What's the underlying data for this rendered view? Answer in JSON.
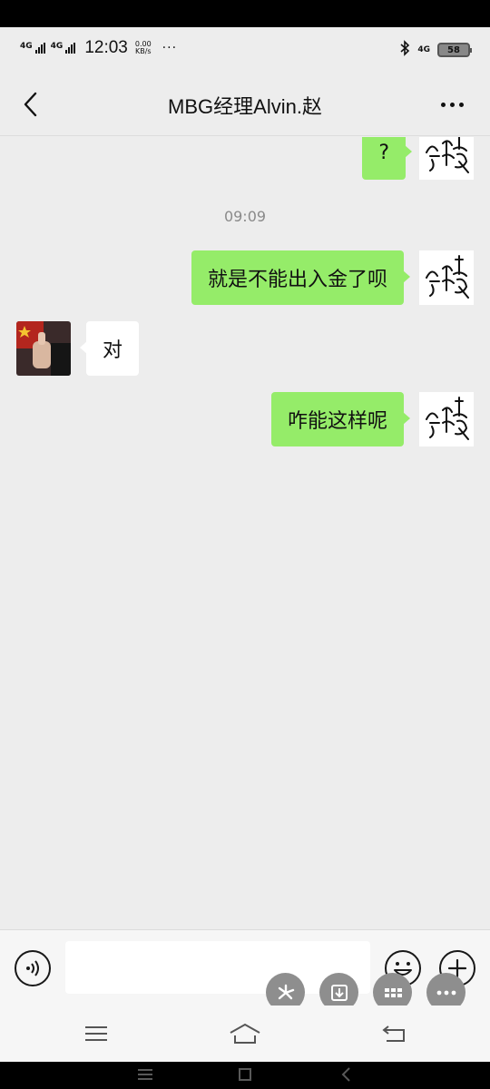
{
  "status_bar": {
    "network_1": "4G",
    "network_2": "4G",
    "time": "12:03",
    "speed_value": "0.00",
    "speed_unit": "KB/s",
    "more": "···",
    "signal_right": "4G",
    "battery": "58"
  },
  "header": {
    "title": "MBG经理Alvin.赵"
  },
  "messages": [
    {
      "side": "me",
      "text": "?"
    },
    {
      "side": "time",
      "text": "09:09"
    },
    {
      "side": "me",
      "text": "就是不能出入金了呗"
    },
    {
      "side": "them",
      "text": "对"
    },
    {
      "side": "me",
      "text": "咋能这样呢"
    }
  ],
  "input": {
    "placeholder": "",
    "value": ""
  },
  "icons": {
    "back": "back-chevron-icon",
    "more": "more-dots-icon",
    "voice": "voice-icon",
    "emoji": "emoji-icon",
    "plus": "plus-icon",
    "float_1": "pinwheel-icon",
    "float_2": "download-icon",
    "float_3": "grid-apps-icon",
    "float_4": "more-horizontal-icon",
    "nav_menu": "menu-icon",
    "nav_home": "home-icon",
    "nav_back": "return-icon"
  },
  "colors": {
    "my_bubble": "#95ec69",
    "their_bubble": "#ffffff",
    "background": "#ededed"
  }
}
